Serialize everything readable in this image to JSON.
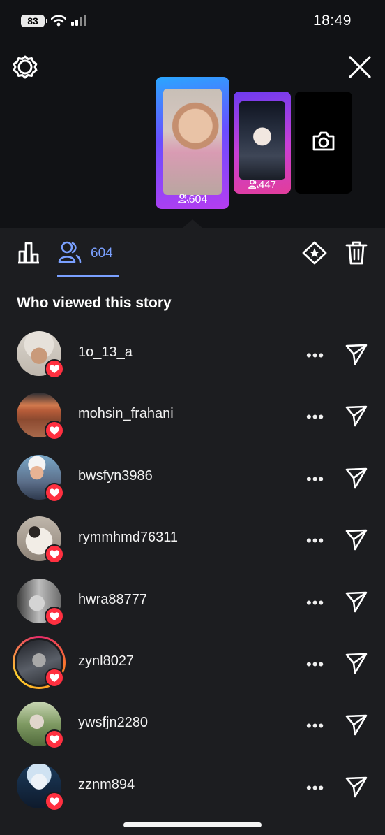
{
  "status_bar": {
    "battery": "83",
    "time": "18:49"
  },
  "story_strip": {
    "current_views": "604",
    "second_views": "447"
  },
  "tabs": {
    "viewers_count": "604"
  },
  "heading": "Who viewed this story",
  "viewers": [
    {
      "username": "1o_13_a",
      "liked": true
    },
    {
      "username": "mohsin_frahani",
      "liked": true
    },
    {
      "username": "bwsfyn3986",
      "liked": true
    },
    {
      "username": "rymmhmd76311",
      "liked": true
    },
    {
      "username": "hwra88777",
      "liked": true
    },
    {
      "username": "zynl8027",
      "liked": true,
      "story_ring": true
    },
    {
      "username": "ywsfjn2280",
      "liked": true
    },
    {
      "username": "zznm894",
      "liked": true
    }
  ],
  "colors": {
    "accent": "#7aa0ff",
    "like": "#ff3040",
    "background": "#1c1d20"
  }
}
